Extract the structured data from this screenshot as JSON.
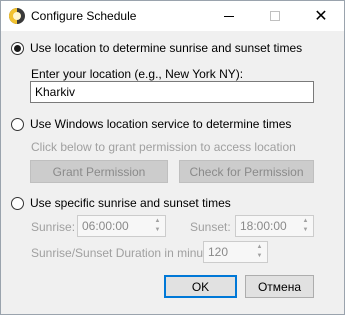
{
  "window": {
    "title": "Configure Schedule",
    "icon": "app-icon",
    "controls": {
      "minimize": "minimize-icon",
      "maximize": "maximize-icon",
      "close": "close-icon"
    }
  },
  "options": {
    "location": {
      "label": "Use location to determine sunrise and sunset times",
      "checked": true,
      "prompt": "Enter your location (e.g., New York NY):",
      "value": "Kharkiv"
    },
    "windows_service": {
      "label": "Use Windows location service to determine times",
      "checked": false,
      "hint": "Click below to grant permission to access location",
      "grant_button": "Grant Permission",
      "check_button": "Check for Permission"
    },
    "specific": {
      "label": "Use specific sunrise and sunset times",
      "checked": false,
      "sunrise_label": "Sunrise:",
      "sunrise_value": "06:00:00",
      "sunset_label": "Sunset:",
      "sunset_value": "18:00:00",
      "duration_label": "Sunrise/Sunset Duration in minutes:",
      "duration_value": "120"
    }
  },
  "footer": {
    "ok": "OK",
    "cancel": "Отмена"
  },
  "colors": {
    "accent": "#0078d7",
    "disabled_text": "#a0a0a0",
    "dialog_bg": "#f0f0f0"
  }
}
